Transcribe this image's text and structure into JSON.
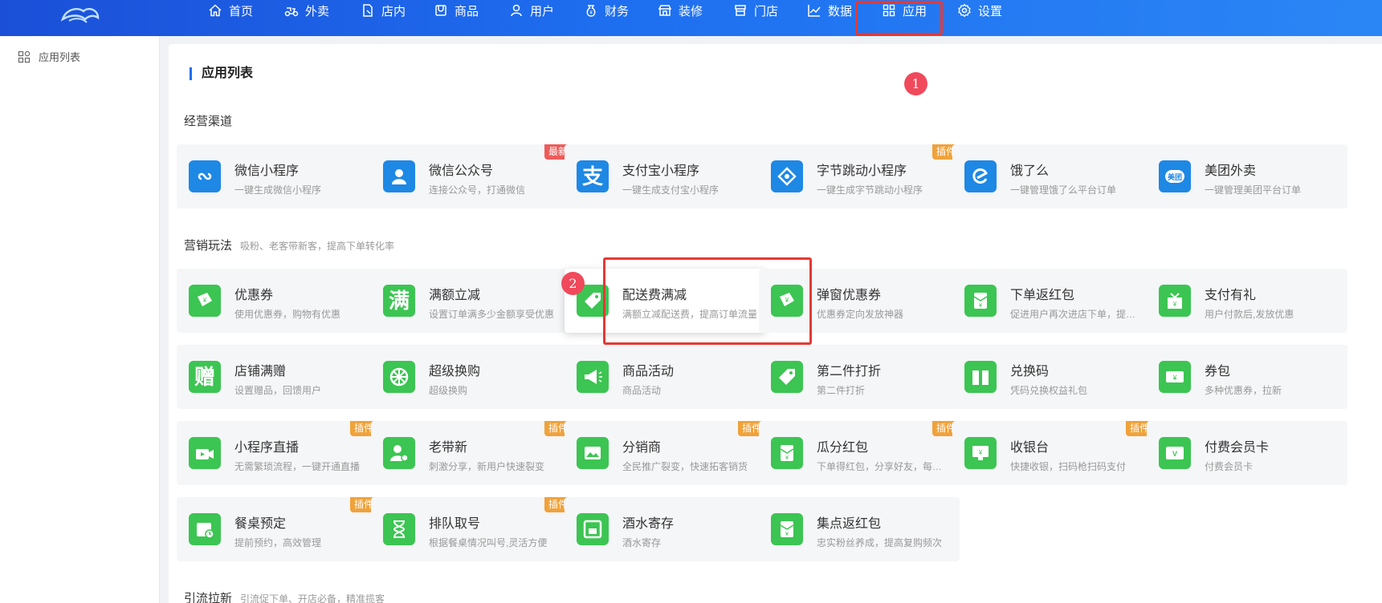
{
  "nav": {
    "items": [
      {
        "label": "首页",
        "icon": "home-icon"
      },
      {
        "label": "外卖",
        "icon": "scooter-icon"
      },
      {
        "label": "店内",
        "icon": "store-doc-icon"
      },
      {
        "label": "商品",
        "icon": "product-icon"
      },
      {
        "label": "用户",
        "icon": "user-icon"
      },
      {
        "label": "财务",
        "icon": "money-bag-icon"
      },
      {
        "label": "装修",
        "icon": "shop-decor-icon"
      },
      {
        "label": "门店",
        "icon": "store-icon"
      },
      {
        "label": "数据",
        "icon": "chart-icon"
      },
      {
        "label": "应用",
        "icon": "apps-grid-icon"
      },
      {
        "label": "设置",
        "icon": "gear-icon"
      }
    ],
    "active": "应用"
  },
  "sidebar": {
    "items": [
      {
        "label": "应用列表",
        "icon": "apps-grid-icon"
      }
    ]
  },
  "page": {
    "title": "应用列表"
  },
  "markers": [
    "1",
    "2"
  ],
  "sections": [
    {
      "title": "经营渠道",
      "subtitle": "",
      "cards": [
        {
          "name": "微信小程序",
          "desc": "一键生成微信小程序",
          "icon": "mini-program-icon",
          "tag": ""
        },
        {
          "name": "微信公众号",
          "desc": "连接公众号，打通微信",
          "icon": "official-account-icon",
          "tag": "最新"
        },
        {
          "name": "支付宝小程序",
          "desc": "一键生成支付宝小程序",
          "icon": "alipay-icon",
          "tag": ""
        },
        {
          "name": "字节跳动小程序",
          "desc": "一键生成字节跳动小程序",
          "icon": "bytedance-icon",
          "tag": "插件"
        },
        {
          "name": "饿了么",
          "desc": "一键管理饿了么平台订单",
          "icon": "eleme-icon",
          "tag": ""
        },
        {
          "name": "美团外卖",
          "desc": "一键管理美团平台订单",
          "icon": "meituan-icon",
          "tag": ""
        }
      ]
    },
    {
      "title": "营销玩法",
      "subtitle": "吸粉、老客带新客，提高下单转化率",
      "cards": [
        {
          "name": "优惠券",
          "desc": "使用优惠券，购物有优惠",
          "icon": "coupon-icon",
          "tag": ""
        },
        {
          "name": "满额立减",
          "desc": "设置订单满多少金额享受优惠",
          "icon": "full-reduction-icon",
          "tag": ""
        },
        {
          "name": "配送费满减",
          "desc": "满额立减配送费，提高订单流量",
          "icon": "delivery-fee-icon",
          "tag": ""
        },
        {
          "name": "弹窗优惠券",
          "desc": "优惠券定向发放神器",
          "icon": "popup-coupon-icon",
          "tag": ""
        },
        {
          "name": "下单返红包",
          "desc": "促进用户再次进店下单，提升复购率",
          "icon": "red-packet-icon",
          "tag": ""
        },
        {
          "name": "支付有礼",
          "desc": "用户付款后,发放优惠",
          "icon": "pay-gift-icon",
          "tag": ""
        },
        {
          "name": "店铺满赠",
          "desc": "设置赠品，回馈用户",
          "icon": "gift-zeng-icon",
          "tag": ""
        },
        {
          "name": "超级换购",
          "desc": "超级换购",
          "icon": "exchange-wheel-icon",
          "tag": ""
        },
        {
          "name": "商品活动",
          "desc": "商品活动",
          "icon": "megaphone-icon",
          "tag": ""
        },
        {
          "name": "第二件打折",
          "desc": "第二件打折",
          "icon": "price-tag-icon",
          "tag": ""
        },
        {
          "name": "兑换码",
          "desc": "凭码兑换权益礼包",
          "icon": "redeem-code-icon",
          "tag": ""
        },
        {
          "name": "券包",
          "desc": "多种优惠券，拉新",
          "icon": "coupon-pack-icon",
          "tag": ""
        },
        {
          "name": "小程序直播",
          "desc": "无需繁琐流程，一键开通直播",
          "icon": "live-camera-icon",
          "tag": "插件"
        },
        {
          "name": "老带新",
          "desc": "刺激分享，新用户快速裂变",
          "icon": "invite-user-icon",
          "tag": "插件"
        },
        {
          "name": "分销商",
          "desc": "全民推广裂变，快速拓客销货",
          "icon": "distributor-icon",
          "tag": "插件"
        },
        {
          "name": "瓜分红包",
          "desc": "下单得红包，分享好友，每人领红包",
          "icon": "split-red-packet-icon",
          "tag": "插件"
        },
        {
          "name": "收银台",
          "desc": "快捷收银，扫码枪扫码支付",
          "icon": "cashier-icon",
          "tag": "插件"
        },
        {
          "name": "付费会员卡",
          "desc": "付费会员卡",
          "icon": "vip-card-icon",
          "tag": ""
        },
        {
          "name": "餐桌预定",
          "desc": "提前预约，高效管理",
          "icon": "table-booking-icon",
          "tag": "插件"
        },
        {
          "name": "排队取号",
          "desc": "根据餐桌情况叫号,灵活方便",
          "icon": "hourglass-icon",
          "tag": "插件"
        },
        {
          "name": "酒水寄存",
          "desc": "酒水寄存",
          "icon": "storage-icon",
          "tag": ""
        },
        {
          "name": "集点返红包",
          "desc": "忠实粉丝养成，提高复购频次",
          "icon": "points-red-packet-icon",
          "tag": ""
        }
      ]
    },
    {
      "title": "引流拉新",
      "subtitle": "引流促下单、开店必备，精准揽客",
      "cards": []
    }
  ],
  "colors": {
    "accent": "#1e6ff0",
    "highlight": "#e53935",
    "marker": "#f0495b",
    "channel_icon": "#1e88e5",
    "marketing_icon": "#3cc552",
    "plugin_tag": "#f0a23a",
    "new_tag": "#ef5a5a"
  }
}
